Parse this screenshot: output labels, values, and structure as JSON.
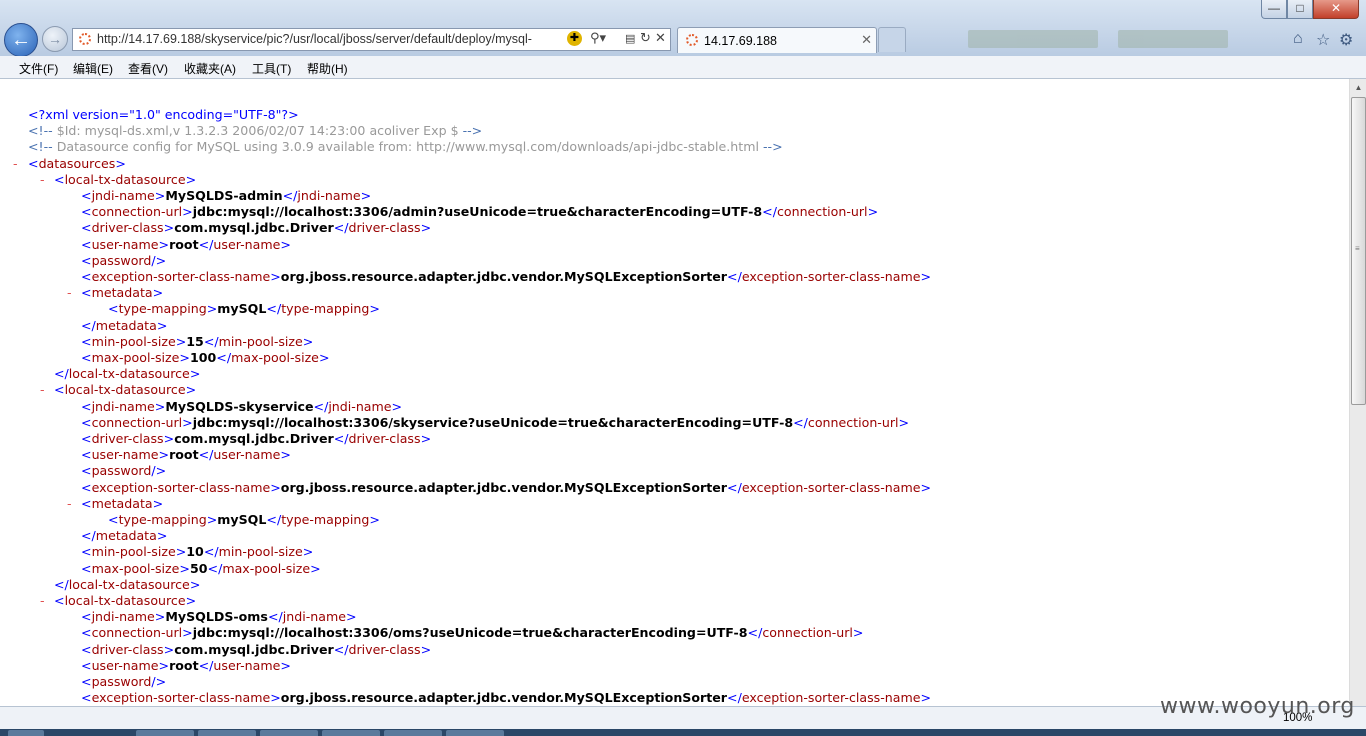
{
  "browser": {
    "address_url": "http://14.17.69.188/skyservice/pic?/usr/local/jboss/server/default/deploy/mysql-",
    "tab_title": "14.17.69.188",
    "icons": [
      "back-icon",
      "forward-icon",
      "compat-view-icon",
      "search-icon",
      "refresh-icon",
      "stop-icon",
      "home-icon",
      "favorites-star-icon",
      "tools-gear-icon"
    ]
  },
  "menu": [
    "文件(F)",
    "编辑(E)",
    "查看(V)",
    "收藏夹(A)",
    "工具(T)",
    "帮助(H)"
  ],
  "xml_lines": [
    {
      "parts": [
        [
          "pi",
          "<?xml version=\"1.0\" encoding=\"UTF-8\"?>"
        ]
      ]
    },
    {
      "parts": [
        [
          "cm-t",
          "<!-- "
        ],
        [
          "cm",
          "$Id: mysql-ds.xml,v 1.3.2.3 2006/02/07 14:23:00 acoliver Exp $ "
        ],
        [
          "cm-t",
          "-->"
        ]
      ]
    },
    {
      "parts": [
        [
          "cm-t",
          "<!-- "
        ],
        [
          "cm",
          "Datasource config for MySQL using 3.0.9 available from: http://www.mysql.com/downloads/api-jdbc-stable.html "
        ],
        [
          "cm-t",
          "-->"
        ]
      ]
    },
    {
      "dash": "-",
      "parts": [
        [
          "br",
          "<"
        ],
        [
          "tg",
          "datasources"
        ],
        [
          "br",
          ">"
        ]
      ]
    },
    {
      "dash": "-",
      "parts": [
        [
          "br",
          "<"
        ],
        [
          "tg",
          "local-tx-datasource"
        ],
        [
          "br",
          ">"
        ]
      ]
    },
    {
      "parts": [
        [
          "br",
          "<"
        ],
        [
          "tg",
          "jndi-name"
        ],
        [
          "br",
          ">"
        ],
        [
          "tx",
          "MySQLDS-admin"
        ],
        [
          "br",
          "</"
        ],
        [
          "tg",
          "jndi-name"
        ],
        [
          "br",
          ">"
        ]
      ]
    },
    {
      "parts": [
        [
          "br",
          "<"
        ],
        [
          "tg",
          "connection-url"
        ],
        [
          "br",
          ">"
        ],
        [
          "tx",
          "jdbc:mysql://localhost:3306/admin?useUnicode=true&characterEncoding=UTF-8"
        ],
        [
          "br",
          "</"
        ],
        [
          "tg",
          "connection-url"
        ],
        [
          "br",
          ">"
        ]
      ]
    },
    {
      "parts": [
        [
          "br",
          "<"
        ],
        [
          "tg",
          "driver-class"
        ],
        [
          "br",
          ">"
        ],
        [
          "tx",
          "com.mysql.jdbc.Driver"
        ],
        [
          "br",
          "</"
        ],
        [
          "tg",
          "driver-class"
        ],
        [
          "br",
          ">"
        ]
      ]
    },
    {
      "parts": [
        [
          "br",
          "<"
        ],
        [
          "tg",
          "user-name"
        ],
        [
          "br",
          ">"
        ],
        [
          "tx",
          "root"
        ],
        [
          "br",
          "</"
        ],
        [
          "tg",
          "user-name"
        ],
        [
          "br",
          ">"
        ]
      ]
    },
    {
      "parts": [
        [
          "br",
          "<"
        ],
        [
          "tg",
          "password"
        ],
        [
          "br",
          "/>"
        ]
      ]
    },
    {
      "parts": [
        [
          "br",
          "<"
        ],
        [
          "tg",
          "exception-sorter-class-name"
        ],
        [
          "br",
          ">"
        ],
        [
          "tx",
          "org.jboss.resource.adapter.jdbc.vendor.MySQLExceptionSorter"
        ],
        [
          "br",
          "</"
        ],
        [
          "tg",
          "exception-sorter-class-name"
        ],
        [
          "br",
          ">"
        ]
      ]
    },
    {
      "dash": "-",
      "parts": [
        [
          "br",
          "<"
        ],
        [
          "tg",
          "metadata"
        ],
        [
          "br",
          ">"
        ]
      ]
    },
    {
      "parts": [
        [
          "br",
          "<"
        ],
        [
          "tg",
          "type-mapping"
        ],
        [
          "br",
          ">"
        ],
        [
          "tx",
          "mySQL"
        ],
        [
          "br",
          "</"
        ],
        [
          "tg",
          "type-mapping"
        ],
        [
          "br",
          ">"
        ]
      ]
    },
    {
      "parts": [
        [
          "br",
          "</"
        ],
        [
          "tg",
          "metadata"
        ],
        [
          "br",
          ">"
        ]
      ]
    },
    {
      "parts": [
        [
          "br",
          "<"
        ],
        [
          "tg",
          "min-pool-size"
        ],
        [
          "br",
          ">"
        ],
        [
          "tx",
          "15"
        ],
        [
          "br",
          "</"
        ],
        [
          "tg",
          "min-pool-size"
        ],
        [
          "br",
          ">"
        ]
      ]
    },
    {
      "parts": [
        [
          "br",
          "<"
        ],
        [
          "tg",
          "max-pool-size"
        ],
        [
          "br",
          ">"
        ],
        [
          "tx",
          "100"
        ],
        [
          "br",
          "</"
        ],
        [
          "tg",
          "max-pool-size"
        ],
        [
          "br",
          ">"
        ]
      ]
    },
    {
      "parts": [
        [
          "br",
          "</"
        ],
        [
          "tg",
          "local-tx-datasource"
        ],
        [
          "br",
          ">"
        ]
      ]
    },
    {
      "dash": "-",
      "parts": [
        [
          "br",
          "<"
        ],
        [
          "tg",
          "local-tx-datasource"
        ],
        [
          "br",
          ">"
        ]
      ]
    },
    {
      "parts": [
        [
          "br",
          "<"
        ],
        [
          "tg",
          "jndi-name"
        ],
        [
          "br",
          ">"
        ],
        [
          "tx",
          "MySQLDS-skyservice"
        ],
        [
          "br",
          "</"
        ],
        [
          "tg",
          "jndi-name"
        ],
        [
          "br",
          ">"
        ]
      ]
    },
    {
      "parts": [
        [
          "br",
          "<"
        ],
        [
          "tg",
          "connection-url"
        ],
        [
          "br",
          ">"
        ],
        [
          "tx",
          "jdbc:mysql://localhost:3306/skyservice?useUnicode=true&characterEncoding=UTF-8"
        ],
        [
          "br",
          "</"
        ],
        [
          "tg",
          "connection-url"
        ],
        [
          "br",
          ">"
        ]
      ]
    },
    {
      "parts": [
        [
          "br",
          "<"
        ],
        [
          "tg",
          "driver-class"
        ],
        [
          "br",
          ">"
        ],
        [
          "tx",
          "com.mysql.jdbc.Driver"
        ],
        [
          "br",
          "</"
        ],
        [
          "tg",
          "driver-class"
        ],
        [
          "br",
          ">"
        ]
      ]
    },
    {
      "parts": [
        [
          "br",
          "<"
        ],
        [
          "tg",
          "user-name"
        ],
        [
          "br",
          ">"
        ],
        [
          "tx",
          "root"
        ],
        [
          "br",
          "</"
        ],
        [
          "tg",
          "user-name"
        ],
        [
          "br",
          ">"
        ]
      ]
    },
    {
      "parts": [
        [
          "br",
          "<"
        ],
        [
          "tg",
          "password"
        ],
        [
          "br",
          "/>"
        ]
      ]
    },
    {
      "parts": [
        [
          "br",
          "<"
        ],
        [
          "tg",
          "exception-sorter-class-name"
        ],
        [
          "br",
          ">"
        ],
        [
          "tx",
          "org.jboss.resource.adapter.jdbc.vendor.MySQLExceptionSorter"
        ],
        [
          "br",
          "</"
        ],
        [
          "tg",
          "exception-sorter-class-name"
        ],
        [
          "br",
          ">"
        ]
      ]
    },
    {
      "dash": "-",
      "parts": [
        [
          "br",
          "<"
        ],
        [
          "tg",
          "metadata"
        ],
        [
          "br",
          ">"
        ]
      ]
    },
    {
      "parts": [
        [
          "br",
          "<"
        ],
        [
          "tg",
          "type-mapping"
        ],
        [
          "br",
          ">"
        ],
        [
          "tx",
          "mySQL"
        ],
        [
          "br",
          "</"
        ],
        [
          "tg",
          "type-mapping"
        ],
        [
          "br",
          ">"
        ]
      ]
    },
    {
      "parts": [
        [
          "br",
          "</"
        ],
        [
          "tg",
          "metadata"
        ],
        [
          "br",
          ">"
        ]
      ]
    },
    {
      "parts": [
        [
          "br",
          "<"
        ],
        [
          "tg",
          "min-pool-size"
        ],
        [
          "br",
          ">"
        ],
        [
          "tx",
          "10"
        ],
        [
          "br",
          "</"
        ],
        [
          "tg",
          "min-pool-size"
        ],
        [
          "br",
          ">"
        ]
      ]
    },
    {
      "parts": [
        [
          "br",
          "<"
        ],
        [
          "tg",
          "max-pool-size"
        ],
        [
          "br",
          ">"
        ],
        [
          "tx",
          "50"
        ],
        [
          "br",
          "</"
        ],
        [
          "tg",
          "max-pool-size"
        ],
        [
          "br",
          ">"
        ]
      ]
    },
    {
      "parts": [
        [
          "br",
          "</"
        ],
        [
          "tg",
          "local-tx-datasource"
        ],
        [
          "br",
          ">"
        ]
      ]
    },
    {
      "dash": "-",
      "parts": [
        [
          "br",
          "<"
        ],
        [
          "tg",
          "local-tx-datasource"
        ],
        [
          "br",
          ">"
        ]
      ]
    },
    {
      "parts": [
        [
          "br",
          "<"
        ],
        [
          "tg",
          "jndi-name"
        ],
        [
          "br",
          ">"
        ],
        [
          "tx",
          "MySQLDS-oms"
        ],
        [
          "br",
          "</"
        ],
        [
          "tg",
          "jndi-name"
        ],
        [
          "br",
          ">"
        ]
      ]
    },
    {
      "parts": [
        [
          "br",
          "<"
        ],
        [
          "tg",
          "connection-url"
        ],
        [
          "br",
          ">"
        ],
        [
          "tx",
          "jdbc:mysql://localhost:3306/oms?useUnicode=true&characterEncoding=UTF-8"
        ],
        [
          "br",
          "</"
        ],
        [
          "tg",
          "connection-url"
        ],
        [
          "br",
          ">"
        ]
      ]
    },
    {
      "parts": [
        [
          "br",
          "<"
        ],
        [
          "tg",
          "driver-class"
        ],
        [
          "br",
          ">"
        ],
        [
          "tx",
          "com.mysql.jdbc.Driver"
        ],
        [
          "br",
          "</"
        ],
        [
          "tg",
          "driver-class"
        ],
        [
          "br",
          ">"
        ]
      ]
    },
    {
      "parts": [
        [
          "br",
          "<"
        ],
        [
          "tg",
          "user-name"
        ],
        [
          "br",
          ">"
        ],
        [
          "tx",
          "root"
        ],
        [
          "br",
          "</"
        ],
        [
          "tg",
          "user-name"
        ],
        [
          "br",
          ">"
        ]
      ]
    },
    {
      "parts": [
        [
          "br",
          "<"
        ],
        [
          "tg",
          "password"
        ],
        [
          "br",
          "/>"
        ]
      ]
    },
    {
      "parts": [
        [
          "br",
          "<"
        ],
        [
          "tg",
          "exception-sorter-class-name"
        ],
        [
          "br",
          ">"
        ],
        [
          "tx",
          "org.jboss.resource.adapter.jdbc.vendor.MySQLExceptionSorter"
        ],
        [
          "br",
          "</"
        ],
        [
          "tg",
          "exception-sorter-class-name"
        ],
        [
          "br",
          ">"
        ]
      ]
    }
  ],
  "status": {
    "zoom": "100%"
  },
  "watermark": "www.wooyun.org",
  "colors": {
    "tag": "#990000",
    "bracket": "#0000ff",
    "comment": "#999999",
    "text": "#000000",
    "collapse_dash": "#e05050"
  }
}
